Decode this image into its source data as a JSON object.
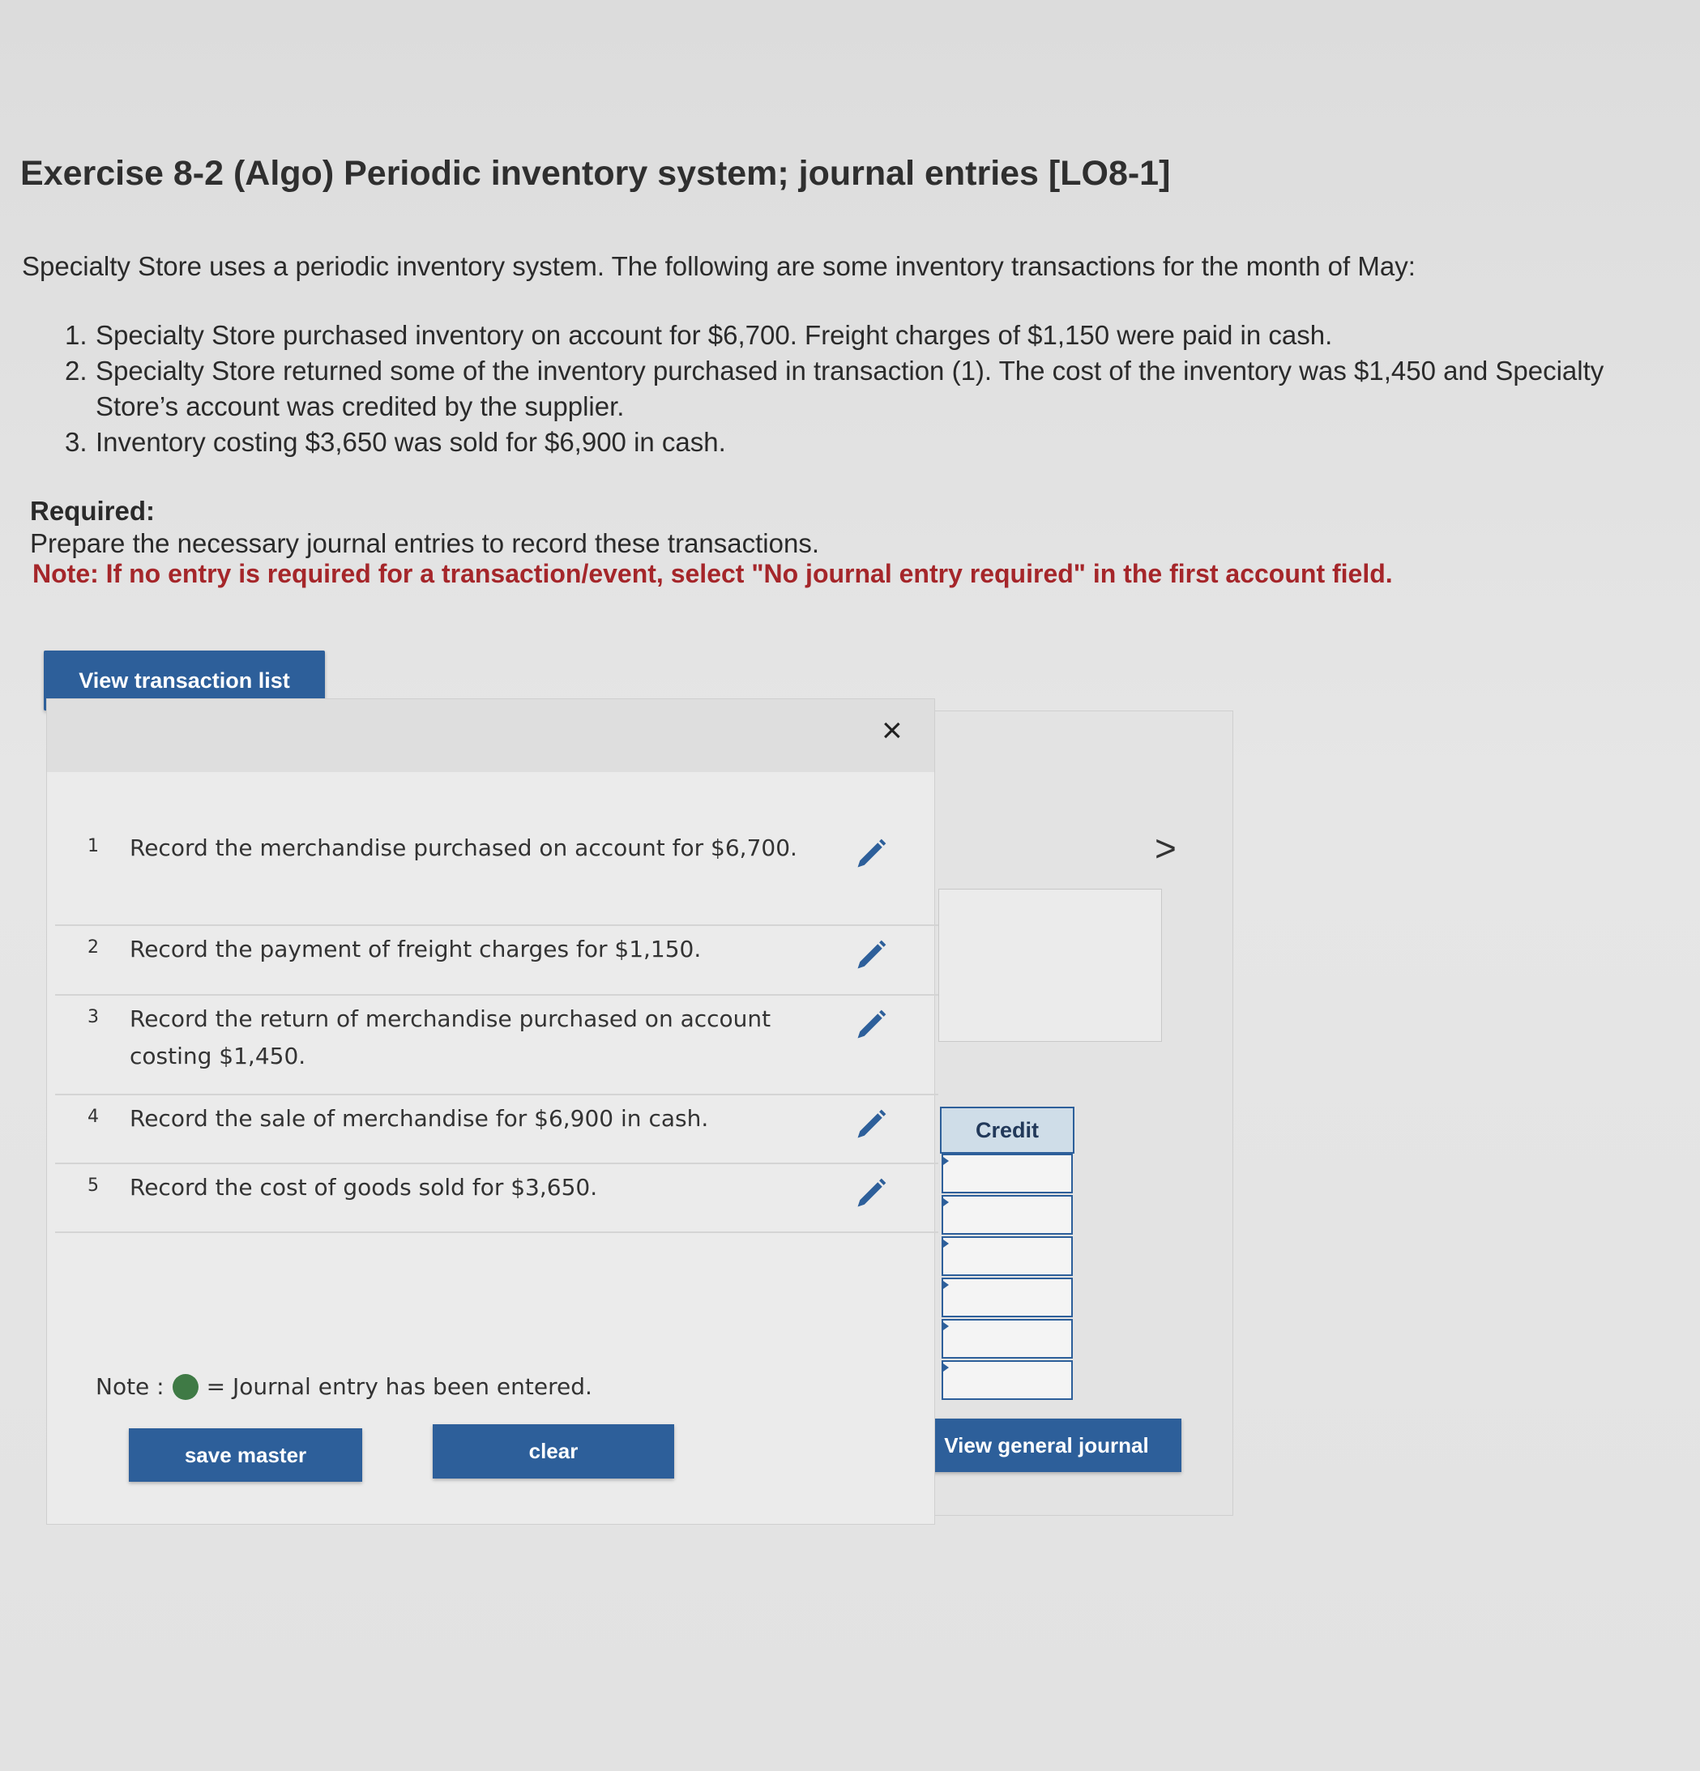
{
  "exercise": {
    "title": "Exercise 8-2 (Algo) Periodic inventory system; journal entries [LO8-1]",
    "intro": "Specialty Store uses a periodic inventory system. The following are some inventory transactions for the month of May:",
    "transactions": [
      {
        "num": "1.",
        "text": "Specialty Store purchased inventory on account for $6,700. Freight charges of $1,150 were paid in cash."
      },
      {
        "num": "2.",
        "text": "Specialty Store returned some of the inventory purchased in transaction (1). The cost of the inventory was $1,450 and Specialty Store’s account was credited by the supplier."
      },
      {
        "num": "3.",
        "text": "Inventory costing $3,650 was sold for $6,900 in cash."
      }
    ],
    "required_heading": "Required:",
    "required_text": "Prepare the necessary journal entries to record these transactions.",
    "note": "Note: If no entry is required for a transaction/event, select \"No journal entry required\" in the first account field."
  },
  "view_transaction_list_label": "View transaction list",
  "modal": {
    "close_symbol": "×",
    "rows": [
      {
        "num": "1",
        "text": "Record the merchandise purchased on account for $6,700."
      },
      {
        "num": "2",
        "text": "Record the payment of freight charges for $1,150."
      },
      {
        "num": "3",
        "text": "Record the return of merchandise purchased on account costing $1,450."
      },
      {
        "num": "4",
        "text": "Record the sale of merchandise for $6,900 in cash."
      },
      {
        "num": "5",
        "text": "Record the cost of goods sold for $3,650."
      }
    ],
    "note_prefix": "Note :",
    "note_suffix": "= Journal entry has been entered.",
    "save_label": "save master",
    "clear_label": "clear"
  },
  "background_panel": {
    "chevron_symbol": ">",
    "credit_header": "Credit"
  },
  "view_general_journal_label": "View general journal",
  "colors": {
    "button_blue": "#2d5f9a",
    "note_red": "#a5262a",
    "entered_dot_green": "#3f7a45"
  },
  "icons": [
    "pencil-icon",
    "close-icon",
    "chevron-right-icon",
    "entered-status-dot"
  ]
}
